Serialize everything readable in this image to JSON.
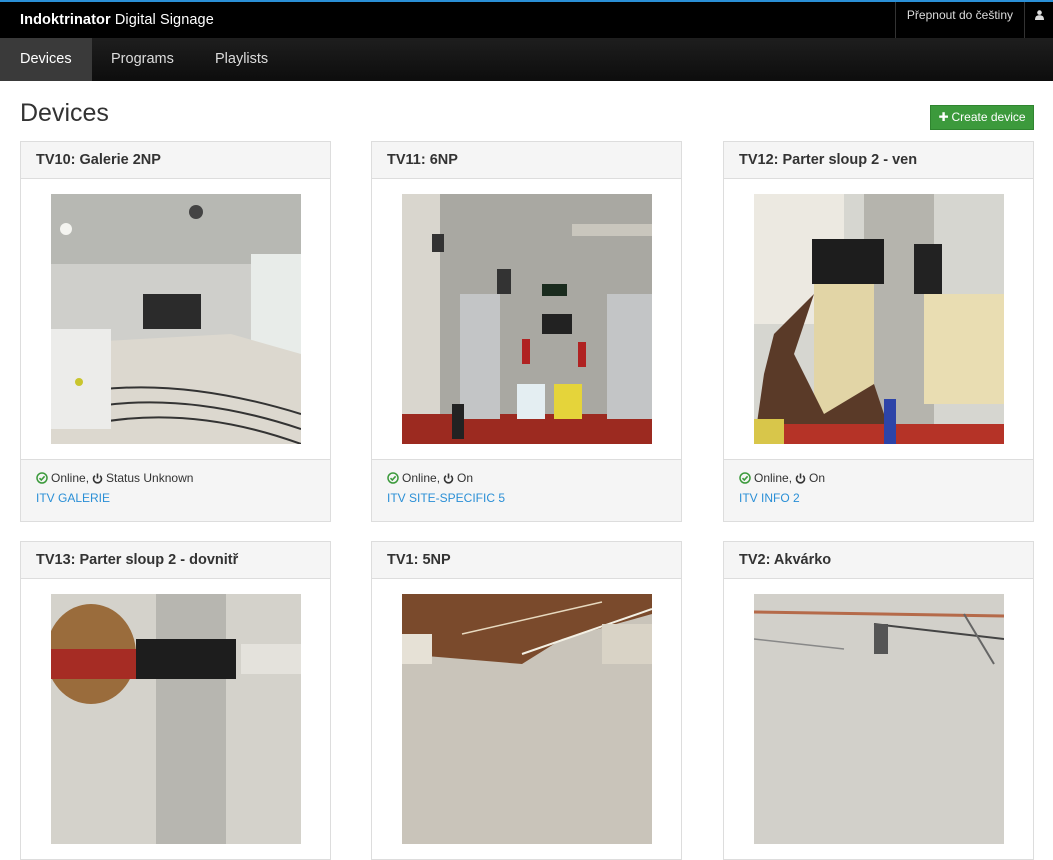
{
  "app": {
    "brand_bold": "Indoktrinator",
    "brand_rest": " Digital Signage",
    "language_switch": "Přepnout do češtiny",
    "user_icon": "user-icon"
  },
  "nav": {
    "items": [
      {
        "label": "Devices",
        "active": true
      },
      {
        "label": "Programs",
        "active": false
      },
      {
        "label": "Playlists",
        "active": false
      }
    ]
  },
  "page": {
    "title": "Devices",
    "create_button": "Create device"
  },
  "devices": [
    {
      "name": "TV10: Galerie 2NP",
      "online": "Online,",
      "power": "Status Unknown",
      "program": "ITV GALERIE"
    },
    {
      "name": "TV11: 6NP",
      "online": "Online,",
      "power": "On",
      "program": "ITV SITE-SPECIFIC 5"
    },
    {
      "name": "TV12: Parter sloup 2 - ven",
      "online": "Online,",
      "power": "On",
      "program": "ITV INFO 2"
    },
    {
      "name": "TV13: Parter sloup 2 - dovnitř"
    },
    {
      "name": "TV1: 5NP"
    },
    {
      "name": "TV2: Akvárko"
    }
  ],
  "colors": {
    "accent": "#2a8fd6",
    "success": "#3c9a3c",
    "online_icon": "#3c9a3c"
  }
}
